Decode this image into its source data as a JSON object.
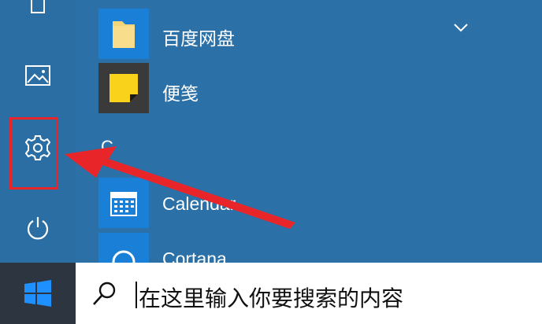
{
  "apps": [
    {
      "label": "百度网盘",
      "icon": "folder-icon"
    },
    {
      "label": "便笺",
      "icon": "sticky-notes-icon"
    },
    {
      "label": "Calendar",
      "icon": "calendar-icon"
    },
    {
      "label": "Cortana",
      "icon": "cortana-icon"
    }
  ],
  "section_letter": "C",
  "rail": [
    "document-icon",
    "pictures-icon",
    "settings-icon",
    "power-icon"
  ],
  "search": {
    "placeholder": "在这里输入你要搜索的内容"
  },
  "colors": {
    "start_bg": "#2b70a7",
    "highlight": "#e8262a",
    "tile_blue": "#1a7fd6",
    "tile_dark": "#3a3a3a",
    "sticky_yellow": "#f9d21c"
  }
}
